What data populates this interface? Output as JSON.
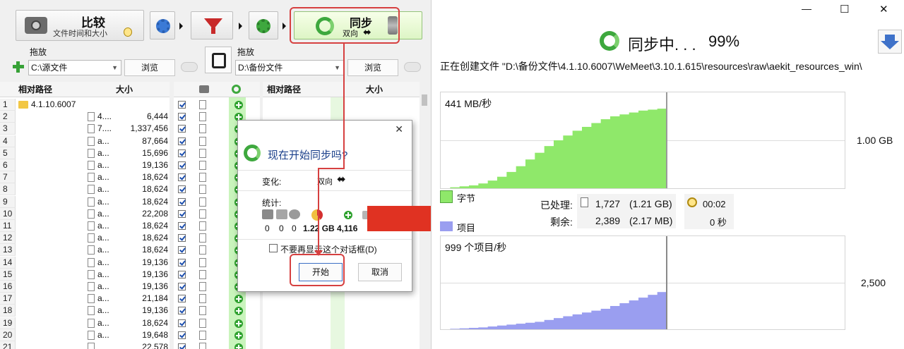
{
  "toolbar": {
    "compare_label": "比较",
    "compare_sub": "文件时间和大小",
    "sync_label": "同步",
    "sync_sub": "双向"
  },
  "left_panel": {
    "drop_label": "拖放",
    "path": "C:\\源文件",
    "browse_label": "浏览",
    "col_path": "相对路径",
    "col_size": "大小",
    "folder": "4.1.10.6007"
  },
  "right_panel": {
    "drop_label": "拖放",
    "path": "D:\\备份文件",
    "browse_label": "浏览",
    "col_path": "相对路径",
    "col_size": "大小"
  },
  "rows": [
    {
      "num": "1",
      "name": "",
      "size": ""
    },
    {
      "num": "2",
      "name": "4....",
      "size": "6,444"
    },
    {
      "num": "3",
      "name": "7....",
      "size": "1,337,456"
    },
    {
      "num": "4",
      "name": "a...",
      "size": "87,664"
    },
    {
      "num": "5",
      "name": "a...",
      "size": "15,696"
    },
    {
      "num": "6",
      "name": "a...",
      "size": "19,136"
    },
    {
      "num": "7",
      "name": "a...",
      "size": "18,624"
    },
    {
      "num": "8",
      "name": "a...",
      "size": "18,624"
    },
    {
      "num": "9",
      "name": "a...",
      "size": "18,624"
    },
    {
      "num": "10",
      "name": "a...",
      "size": "22,208"
    },
    {
      "num": "11",
      "name": "a...",
      "size": "18,624"
    },
    {
      "num": "12",
      "name": "a...",
      "size": "18,624"
    },
    {
      "num": "13",
      "name": "a...",
      "size": "18,624"
    },
    {
      "num": "14",
      "name": "a...",
      "size": "19,136"
    },
    {
      "num": "15",
      "name": "a...",
      "size": "19,136"
    },
    {
      "num": "16",
      "name": "a...",
      "size": "19,136"
    },
    {
      "num": "17",
      "name": "a...",
      "size": "21,184"
    },
    {
      "num": "18",
      "name": "a...",
      "size": "19,136"
    },
    {
      "num": "19",
      "name": "a...",
      "size": "18,624"
    },
    {
      "num": "20",
      "name": "a...",
      "size": "19,648"
    },
    {
      "num": "21",
      "name": "",
      "size": "22,578"
    }
  ],
  "dialog": {
    "title": "现在开始同步吗?",
    "change_label": "变化:",
    "change_value": "双向",
    "stats_label": "统计:",
    "stats": [
      "0",
      "0",
      "0",
      "1.22 GB",
      "4,116"
    ],
    "dont_show": "不要再显示这个对话框(D)",
    "start_label": "开始",
    "cancel_label": "取消"
  },
  "progress": {
    "title": "同步中. . .",
    "percent": "99%",
    "status_text": "正在创建文件 \"D:\\备份文件\\4.1.10.6007\\WeMeet\\3.10.1.615\\resources\\raw\\aekit_resources_win\\",
    "chart1_label": "441 MB/秒",
    "chart1_axis": "1.00 GB",
    "legend_bytes": "字节",
    "legend_items": "项目",
    "processed_label": "已处理:",
    "processed_value": "1,727",
    "processed_size": "(1.21 GB)",
    "remaining_label": "剩余:",
    "remaining_value": "2,389",
    "remaining_size": "(2.17 MB)",
    "elapsed": "00:02",
    "remaining_time": "0 秒",
    "chart2_label": "999 个项目/秒",
    "chart2_axis": "2,500"
  },
  "chart_data": [
    {
      "type": "area",
      "series": [
        {
          "name": "字节",
          "values": [
            0,
            0.01,
            0.02,
            0.03,
            0.05,
            0.08,
            0.12,
            0.17,
            0.23,
            0.3,
            0.37,
            0.44,
            0.5,
            0.55,
            0.6,
            0.64,
            0.68,
            0.72,
            0.75,
            0.77,
            0.79,
            0.81,
            0.82,
            0.83
          ]
        }
      ]
    },
    {
      "type": "area",
      "series": [
        {
          "name": "项目",
          "values": [
            0,
            0.005,
            0.01,
            0.015,
            0.02,
            0.03,
            0.04,
            0.05,
            0.06,
            0.07,
            0.08,
            0.1,
            0.12,
            0.14,
            0.16,
            0.18,
            0.2,
            0.22,
            0.25,
            0.28,
            0.31,
            0.34,
            0.37,
            0.4
          ]
        }
      ]
    }
  ],
  "colors": {
    "sync_green": "#3ea83e",
    "bytes_fill": "#8fe86a",
    "items_fill": "#9a9ef0",
    "annot_red": "#d64040"
  },
  "window": {
    "minimize": "—",
    "maximize": "☐",
    "close": "✕"
  }
}
